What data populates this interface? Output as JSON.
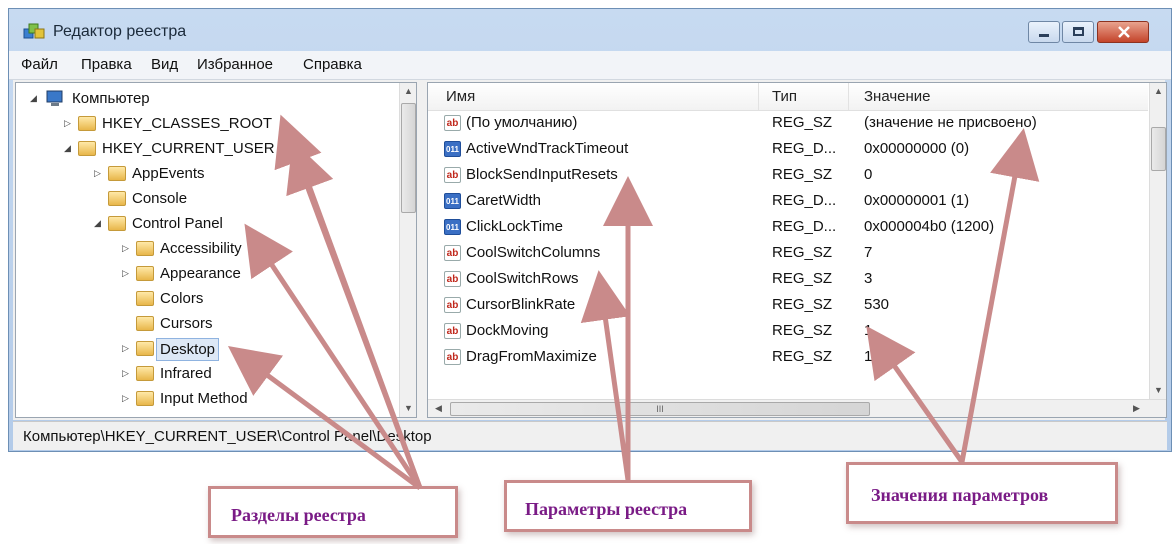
{
  "window": {
    "title": "Редактор реестра"
  },
  "menu": [
    "Файл",
    "Правка",
    "Вид",
    "Избранное",
    "Справка"
  ],
  "tree": {
    "root": "Компьютер",
    "items": [
      {
        "label": "HKEY_CLASSES_ROOT"
      },
      {
        "label": "HKEY_CURRENT_USER"
      },
      {
        "label": "AppEvents"
      },
      {
        "label": "Console"
      },
      {
        "label": "Control Panel"
      },
      {
        "label": "Accessibility"
      },
      {
        "label": "Appearance"
      },
      {
        "label": "Colors"
      },
      {
        "label": "Cursors"
      },
      {
        "label": "Desktop"
      },
      {
        "label": "Infrared"
      },
      {
        "label": "Input Method"
      }
    ]
  },
  "list": {
    "columns": [
      "Имя",
      "Тип",
      "Значение"
    ],
    "rows": [
      {
        "name": "(По умолчанию)",
        "type": "REG_SZ",
        "value": "(значение не присвоено)",
        "icon": "string-value-icon"
      },
      {
        "name": "ActiveWndTrackTimeout",
        "type": "REG_D...",
        "value": "0x00000000 (0)",
        "icon": "binary-value-icon"
      },
      {
        "name": "BlockSendInputResets",
        "type": "REG_SZ",
        "value": "0",
        "icon": "string-value-icon"
      },
      {
        "name": "CaretWidth",
        "type": "REG_D...",
        "value": "0x00000001 (1)",
        "icon": "binary-value-icon"
      },
      {
        "name": "ClickLockTime",
        "type": "REG_D...",
        "value": "0x000004b0 (1200)",
        "icon": "binary-value-icon"
      },
      {
        "name": "CoolSwitchColumns",
        "type": "REG_SZ",
        "value": "7",
        "icon": "string-value-icon"
      },
      {
        "name": "CoolSwitchRows",
        "type": "REG_SZ",
        "value": "3",
        "icon": "string-value-icon"
      },
      {
        "name": "CursorBlinkRate",
        "type": "REG_SZ",
        "value": "530",
        "icon": "string-value-icon"
      },
      {
        "name": "DockMoving",
        "type": "REG_SZ",
        "value": "1",
        "icon": "string-value-icon"
      },
      {
        "name": "DragFromMaximize",
        "type": "REG_SZ",
        "value": "1",
        "icon": "string-value-icon"
      }
    ]
  },
  "icons": {
    "sz_glyph": "ab",
    "dword_glyph": "011",
    "scroll_mid": "III"
  },
  "status": {
    "path": "Компьютер\\HKEY_CURRENT_USER\\Control Panel\\Desktop"
  },
  "callouts": {
    "sections": "Разделы реестра",
    "parameters": "Параметры реестра",
    "values": "Значения параметров"
  },
  "colors": {
    "callout_text": "#7a1b86",
    "callout_border": "#c98a8a",
    "arrow": "#c98a8a",
    "selection": "#dde8f6"
  }
}
